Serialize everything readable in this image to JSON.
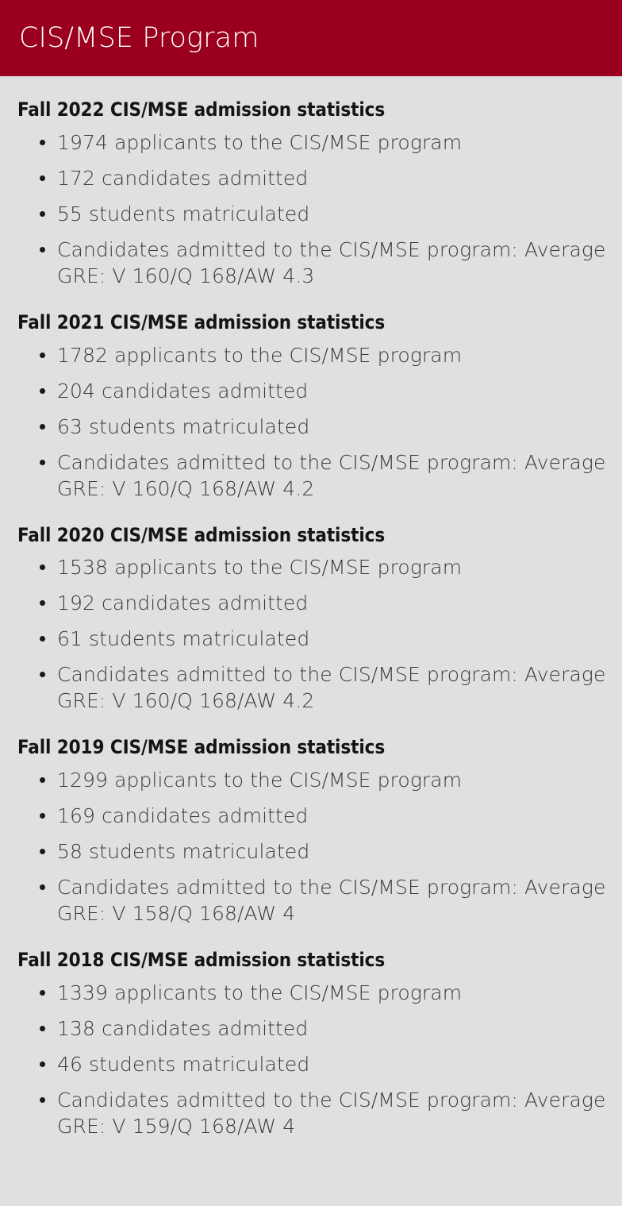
{
  "header": {
    "title": "CIS/MSE Program",
    "background_color": "#9a001e",
    "text_color": "#ffffff"
  },
  "page": {
    "background_color": "#dfe0e2",
    "text_color": "#3a3a3a",
    "heading_color": "#141414"
  },
  "sections": [
    {
      "heading": "Fall 2022 CIS/MSE admission statistics",
      "items": [
        "1974 applicants to the CIS/MSE program",
        "172 candidates admitted",
        "55 students matriculated",
        "Candidates admitted to the CIS/MSE program: Average GRE: V 160/Q 168/AW 4.3"
      ]
    },
    {
      "heading": "Fall 2021 CIS/MSE admission statistics",
      "items": [
        "1782 applicants to the CIS/MSE program",
        "204 candidates admitted",
        "63 students matriculated",
        "Candidates admitted to the CIS/MSE program: Average GRE: V 160/Q 168/AW 4.2"
      ]
    },
    {
      "heading": "Fall 2020 CIS/MSE admission statistics",
      "items": [
        "1538 applicants to the CIS/MSE program",
        "192 candidates admitted",
        "61 students matriculated",
        "Candidates admitted to the CIS/MSE program: Average GRE: V 160/Q 168/AW 4.2"
      ]
    },
    {
      "heading": "Fall 2019 CIS/MSE admission statistics",
      "items": [
        "1299 applicants to the CIS/MSE program",
        "169 candidates admitted",
        "58 students matriculated",
        "Candidates admitted to the CIS/MSE program: Average GRE: V 158/Q 168/AW 4"
      ]
    },
    {
      "heading": "Fall 2018 CIS/MSE admission statistics",
      "items": [
        "1339 applicants to the CIS/MSE program",
        "138 candidates admitted",
        "46 students matriculated",
        "Candidates admitted to the CIS/MSE program: Average GRE: V 159/Q 168/AW 4"
      ]
    }
  ]
}
